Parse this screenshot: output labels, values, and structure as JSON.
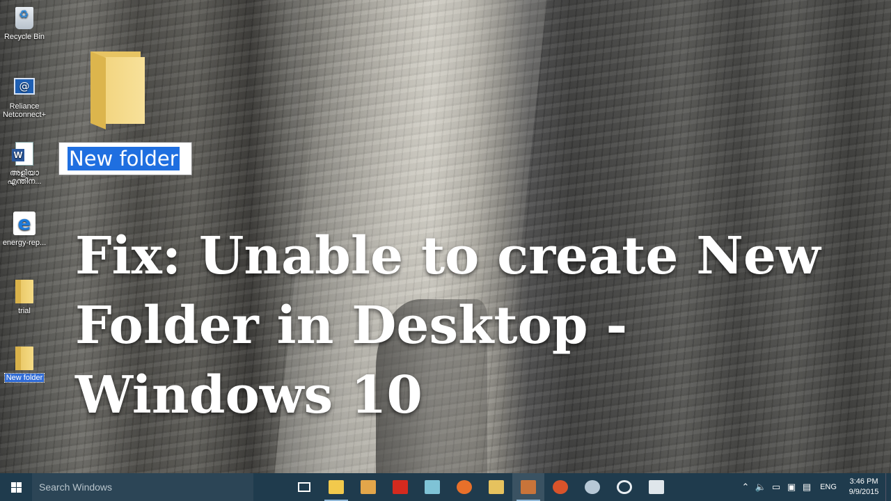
{
  "desktop": {
    "icons": [
      {
        "label": "Recycle Bin",
        "icon": "recycle-bin-icon"
      },
      {
        "label": "Reliance Netconnect+",
        "icon": "network-connect-icon"
      },
      {
        "label": "അളിയാ എന്തിന...",
        "icon": "word-document-icon"
      },
      {
        "label": "energy-rep...",
        "icon": "edge-browser-icon"
      },
      {
        "label": "trial",
        "icon": "folder-icon"
      },
      {
        "label": "New folder",
        "icon": "folder-icon",
        "selected": true
      }
    ],
    "rename_box": {
      "value": "New folder"
    }
  },
  "headline": {
    "line1": "Fix: Unable to create New",
    "line2": "Folder in Desktop -",
    "line3": "Windows 10"
  },
  "taskbar": {
    "search_placeholder": "Search Windows",
    "apps": [
      {
        "name": "task-view",
        "icon": "task-view-icon"
      },
      {
        "name": "file-explorer",
        "icon": "file-explorer-icon",
        "color": "#f2c94c",
        "running": true
      },
      {
        "name": "word",
        "icon": "word-icon",
        "color": "#e3a64a"
      },
      {
        "name": "acrobat",
        "icon": "acrobat-icon",
        "color": "#d42a1e"
      },
      {
        "name": "notes",
        "icon": "notepad-icon",
        "color": "#7fc3d6"
      },
      {
        "name": "firefox",
        "icon": "firefox-icon",
        "color": "#e8702a"
      },
      {
        "name": "folder",
        "icon": "folder-icon",
        "color": "#e6c25e"
      },
      {
        "name": "tool",
        "icon": "toolbox-icon",
        "color": "#c8743a",
        "active": true
      },
      {
        "name": "media",
        "icon": "ape-icon",
        "color": "#d9532a"
      },
      {
        "name": "paint",
        "icon": "paint-icon",
        "color": "#b7c8d6"
      },
      {
        "name": "disc",
        "icon": "disc-burner-icon",
        "color": "#e9eef2"
      },
      {
        "name": "movie",
        "icon": "movie-maker-icon",
        "color": "#dfe6eb"
      }
    ],
    "tray": {
      "language": "ENG",
      "time": "3:46 PM",
      "date": "9/9/2015"
    }
  }
}
